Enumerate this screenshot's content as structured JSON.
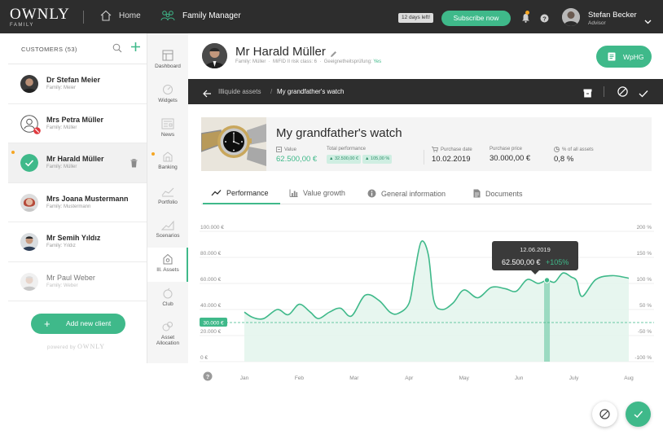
{
  "brand": {
    "name": "OWNLY",
    "sub": "FAMILY"
  },
  "topbar": {
    "home_label": "Home",
    "family_manager_label": "Family Manager",
    "trial_badge": "12 days left!",
    "subscribe_label": "Subscribe now",
    "user": {
      "name": "Stefan Becker",
      "role": "Advisor"
    }
  },
  "sidebar": {
    "title": "CUSTOMERS (53)",
    "customers": [
      {
        "name": "Dr Stefan Meier",
        "family": "Family: Meier"
      },
      {
        "name": "Mrs Petra Müller",
        "family": "Family: Müller"
      },
      {
        "name": "Mr Harald Müller",
        "family": "Family: Müller"
      },
      {
        "name": "Mrs Joana Mustermann",
        "family": "Family: Mustermann"
      },
      {
        "name": "Mr Semih Yıldız",
        "family": "Family: Yıldız"
      },
      {
        "name": "Mr Paul Weber",
        "family": "Family: Weber"
      }
    ],
    "add_label": "Add new client",
    "powered_by": "powered by",
    "powered_brand": "OWNLY"
  },
  "modules": {
    "dashboard": "Dashboard",
    "widgets": "Widgets",
    "news": "News",
    "banking": "Banking",
    "portfolio": "Portfolio",
    "scenarios": "Scenarios",
    "ill_assets_1": "Ill.",
    "ill_assets_2": "Assets",
    "club": "Club",
    "asset_allocation_1": "Asset",
    "asset_allocation_2": "Allocation"
  },
  "client": {
    "name": "Mr Harald Müller",
    "family": "Family: Müller",
    "mifid": "MiFID II risk class: 6",
    "suitability_label": "Geeignetheitsprüfung:",
    "suitability_value": "Yes",
    "wphg_label": "WpHG"
  },
  "breadcrumb": {
    "parent": "Illiquide assets",
    "separator": "/",
    "current": "My grandfather's watch"
  },
  "asset": {
    "title": "My grandfather's watch",
    "value_label": "Value",
    "value": "62.500,00 €",
    "performance_label": "Total performance",
    "performance_abs": "32.500,00 €",
    "performance_pct": "105,00 %",
    "purchase_date_label": "Purchase date",
    "purchase_date": "10.02.2019",
    "purchase_price_label": "Purchase price",
    "purchase_price": "30.000,00 €",
    "share_label": "% of all assets",
    "share": "0,8 %"
  },
  "tabs": [
    {
      "label": "Performance"
    },
    {
      "label": "Value growth"
    },
    {
      "label": "General information"
    },
    {
      "label": "Documents"
    }
  ],
  "tooltip": {
    "date": "12.06.2019",
    "amount": "62.500,00 €",
    "pct": "+105%"
  },
  "colors": {
    "accent": "#3fb98a",
    "dark": "#2d2d2d",
    "fill": "#e3f4ec"
  },
  "chart_data": {
    "type": "area",
    "x_labels": [
      "Jan",
      "Feb",
      "Mar",
      "Apr",
      "May",
      "Jun",
      "July",
      "Aug"
    ],
    "y_left_ticks": [
      "100.000 €",
      "80.000 €",
      "60.000 €",
      "40.000 €",
      "20.000 €",
      "0 €"
    ],
    "y_right_ticks": [
      "200 %",
      "150 %",
      "100 %",
      "50 %",
      "-50 %",
      "-100 %"
    ],
    "purchase_price_marker": "30.000 €",
    "purchase_price_value": 30000,
    "ylim": [
      0,
      100000
    ],
    "highlight_x": 5.51,
    "series": [
      {
        "x": [
          0,
          0.15,
          0.35,
          0.6,
          0.8,
          1.0,
          1.2,
          1.35,
          1.55,
          1.75,
          1.95,
          2.2,
          2.45,
          2.65,
          2.8,
          3.0,
          3.1,
          3.22,
          3.35,
          3.45,
          3.6,
          3.8,
          4.0,
          4.25,
          4.5,
          4.75,
          4.95,
          5.15,
          5.35,
          5.51,
          5.65,
          5.8,
          5.95,
          6.05,
          6.15,
          6.4,
          6.7,
          7.0
        ],
        "values": [
          38000,
          34000,
          33000,
          40000,
          36000,
          44000,
          38000,
          33000,
          38000,
          41000,
          35000,
          51000,
          47000,
          38000,
          37000,
          45000,
          68000,
          92000,
          82000,
          47000,
          40000,
          45000,
          55000,
          49000,
          57000,
          56000,
          54000,
          63000,
          60000,
          62500,
          61000,
          68000,
          65000,
          62000,
          50000,
          63000,
          66000,
          64000
        ]
      }
    ]
  }
}
